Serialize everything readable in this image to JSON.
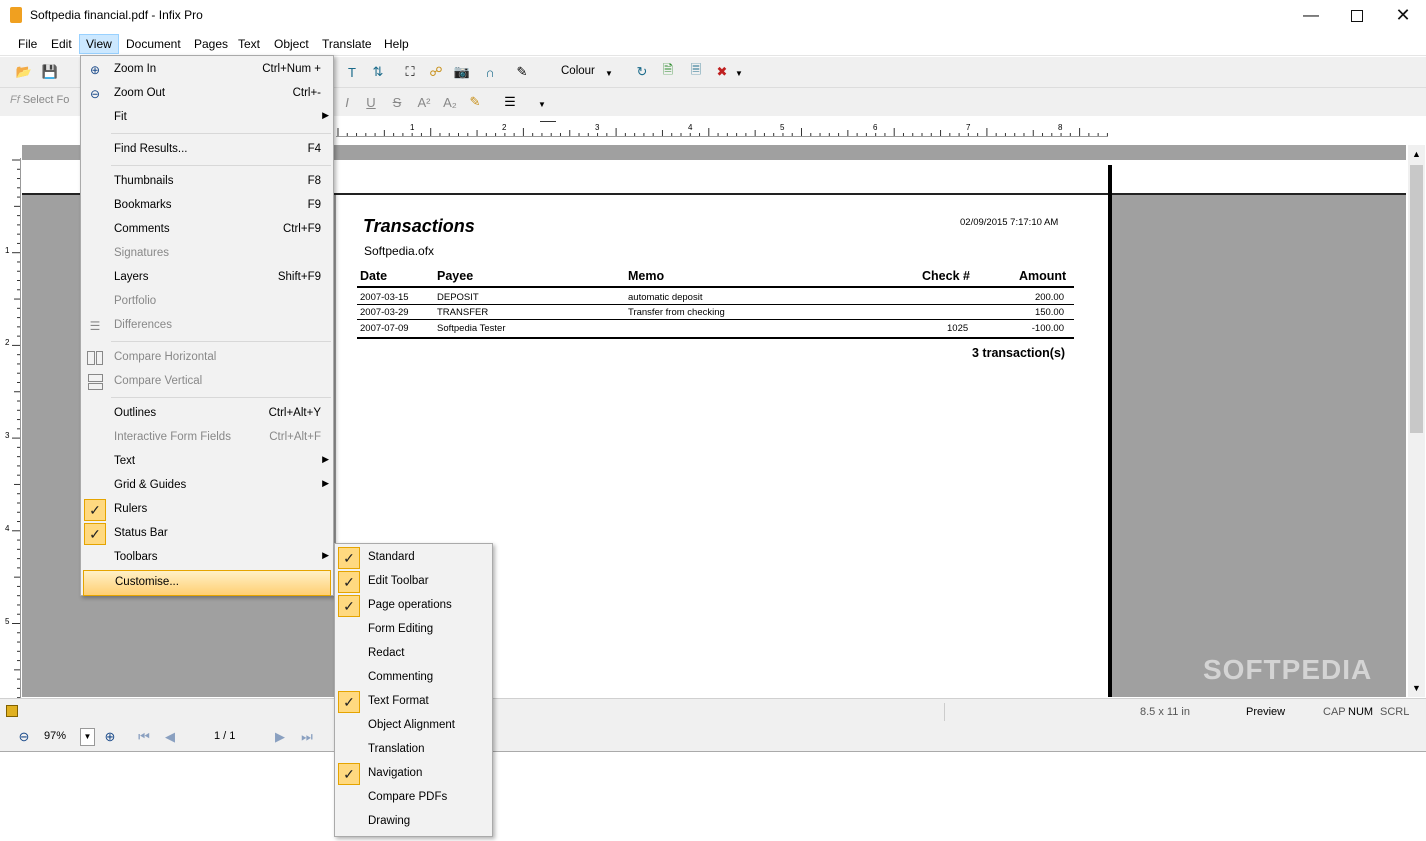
{
  "window": {
    "title": "Softpedia financial.pdf - Infix Pro"
  },
  "menubar": [
    "File",
    "Edit",
    "View",
    "Document",
    "Pages",
    "Text",
    "Object",
    "Translate",
    "Help"
  ],
  "toolbar": {
    "colour_label": "Colour",
    "select_font_placeholder": "Select Fo"
  },
  "view_menu": [
    {
      "label": "Zoom In",
      "shortcut": "Ctrl+Num +",
      "icon": "zoom-in-icon"
    },
    {
      "label": "Zoom Out",
      "shortcut": "Ctrl+-",
      "icon": "zoom-out-icon"
    },
    {
      "label": "Fit",
      "submenu": true
    },
    {
      "label": "Find Results...",
      "shortcut": "F4"
    },
    {
      "label": "Thumbnails",
      "shortcut": "F8"
    },
    {
      "label": "Bookmarks",
      "shortcut": "F9"
    },
    {
      "label": "Comments",
      "shortcut": "Ctrl+F9"
    },
    {
      "label": "Signatures",
      "disabled": true
    },
    {
      "label": "Layers",
      "shortcut": "Shift+F9"
    },
    {
      "label": "Portfolio",
      "disabled": true
    },
    {
      "label": "Differences",
      "disabled": true,
      "icon": "list-icon"
    },
    {
      "label": "Compare Horizontal",
      "disabled": true,
      "icon": "compare-horizontal-icon"
    },
    {
      "label": "Compare Vertical",
      "disabled": true,
      "icon": "compare-vertical-icon"
    },
    {
      "label": "Outlines",
      "shortcut": "Ctrl+Alt+Y"
    },
    {
      "label": "Interactive Form Fields",
      "shortcut": "Ctrl+Alt+F",
      "disabled": true
    },
    {
      "label": "Text",
      "submenu": true
    },
    {
      "label": "Grid & Guides",
      "submenu": true
    },
    {
      "label": "Rulers",
      "checked": true
    },
    {
      "label": "Status Bar",
      "checked": true
    },
    {
      "label": "Toolbars",
      "submenu": true
    },
    {
      "label": "Customise...",
      "highlighted": true
    }
  ],
  "toolbars_submenu": [
    {
      "label": "Standard",
      "checked": true
    },
    {
      "label": "Edit Toolbar",
      "checked": true
    },
    {
      "label": "Page operations",
      "checked": true
    },
    {
      "label": "Form Editing",
      "checked": false
    },
    {
      "label": "Redact",
      "checked": false
    },
    {
      "label": "Commenting",
      "checked": false
    },
    {
      "label": "Text Format",
      "checked": true
    },
    {
      "label": "Object Alignment",
      "checked": false
    },
    {
      "label": "Translation",
      "checked": false
    },
    {
      "label": "Navigation",
      "checked": true
    },
    {
      "label": "Compare PDFs",
      "checked": false
    },
    {
      "label": "Drawing",
      "checked": false
    }
  ],
  "ruler": {
    "h_labels": [
      "1",
      "2",
      "3",
      "4",
      "5",
      "6",
      "7",
      "8"
    ],
    "v_labels": [
      "1",
      "2",
      "3",
      "4",
      "5"
    ]
  },
  "document": {
    "title": "Transactions",
    "timestamp": "02/09/2015 7:17:10 AM",
    "file": "Softpedia.ofx",
    "headers": {
      "date": "Date",
      "payee": "Payee",
      "memo": "Memo",
      "check": "Check #",
      "amount": "Amount"
    },
    "rows": [
      {
        "date": "2007-03-15",
        "payee": "DEPOSIT",
        "memo": "automatic deposit",
        "check": "",
        "amount": "200.00"
      },
      {
        "date": "2007-03-29",
        "payee": "TRANSFER",
        "memo": "Transfer from checking",
        "check": "",
        "amount": "150.00"
      },
      {
        "date": "2007-07-09",
        "payee": "Softpedia Tester",
        "memo": "",
        "check": "1025",
        "amount": "-100.00"
      }
    ],
    "summary": "3 transaction(s)"
  },
  "statusbar": {
    "page_size": "8.5 x 11 in",
    "mode": "Preview",
    "cap": "CAP",
    "num": "NUM",
    "scrl": "SCRL"
  },
  "navbar": {
    "zoom": "97%",
    "page": "1 / 1"
  },
  "watermark": "SOFTPEDIA"
}
